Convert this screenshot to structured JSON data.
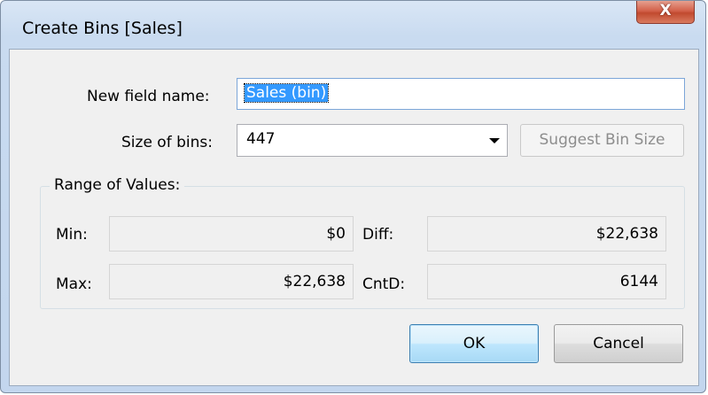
{
  "window": {
    "title": "Create Bins [Sales]",
    "close_glyph": "X"
  },
  "form": {
    "new_field_label": "New field name:",
    "new_field_value": "Sales (bin)",
    "size_label": "Size of bins:",
    "size_value": "447",
    "suggest_button": "Suggest Bin Size"
  },
  "range": {
    "title": "Range of Values:",
    "min_label": "Min:",
    "min_value": "$0",
    "max_label": "Max:",
    "max_value": "$22,638",
    "diff_label": "Diff:",
    "diff_value": "$22,638",
    "cntd_label": "CntD:",
    "cntd_value": "6144"
  },
  "buttons": {
    "ok": "OK",
    "cancel": "Cancel"
  },
  "colors": {
    "selection": "#3399ff",
    "close_button": "#c14a2f",
    "default_button_border": "#3c7fb1"
  }
}
